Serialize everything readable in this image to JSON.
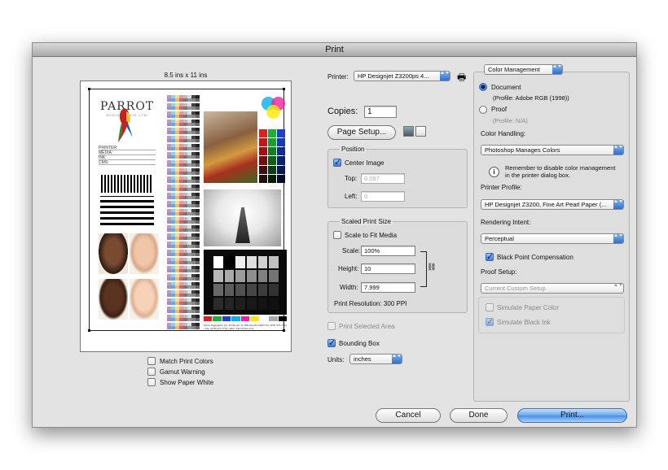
{
  "window": {
    "title": "Print"
  },
  "preview": {
    "paper_size": "8.5 ins x 11 ins",
    "page": {
      "logo_text": "PARROT",
      "logo_sub": "DIGIGRAPHIC LTD",
      "info_lines": [
        "PRINTER:",
        "MEDIA:",
        "INK:",
        "CMS:"
      ],
      "footer": "Parrot Digigraphic Ltd. 4i3 Boston St. Billerica MA 01821 Tel: (978) 670-7744 • Fax: (978) 670-7744 • Web: ParrotColor.com"
    },
    "checkboxes": [
      {
        "label": "Match Print Colors",
        "checked": false
      },
      {
        "label": "Gamut Warning",
        "checked": false
      },
      {
        "label": "Show Paper White",
        "checked": false
      }
    ]
  },
  "middle": {
    "printer_label": "Printer:",
    "printer_value": "HP Designjet Z3200ps 4...",
    "copies_label": "Copies:",
    "copies_value": "1",
    "page_setup_label": "Page Setup...",
    "position": {
      "title": "Position",
      "center_image_label": "Center Image",
      "center_image_checked": true,
      "top_label": "Top:",
      "top_value": "0.097",
      "left_label": "Left:",
      "left_value": "0"
    },
    "scaled": {
      "title": "Scaled Print Size",
      "scale_to_fit_label": "Scale to Fit Media",
      "scale_to_fit_checked": false,
      "scale_label": "Scale:",
      "scale_value": "100%",
      "height_label": "Height:",
      "height_value": "10",
      "width_label": "Width:",
      "width_value": "7.999",
      "resolution_label": "Print Resolution: 300 PPI"
    },
    "print_selected_area_label": "Print Selected Area",
    "bounding_box_label": "Bounding Box",
    "bounding_box_checked": true,
    "units_label": "Units:",
    "units_value": "inches"
  },
  "right": {
    "mode_value": "Color Management",
    "document_label": "Document",
    "document_profile": "(Profile: Adobe RGB (1998))",
    "proof_label": "Proof",
    "proof_profile": "(Profile: N/A)",
    "color_handling_label": "Color Handling:",
    "color_handling_value": "Photoshop Manages Colors",
    "reminder_text_1": "Remember to disable color management",
    "reminder_text_2": "in the printer dialog box.",
    "printer_profile_label": "Printer Profile:",
    "printer_profile_value": "HP Designjet Z3200, Fine Art Pearl Paper (...",
    "rendering_intent_label": "Rendering Intent:",
    "rendering_intent_value": "Perceptual",
    "bpc_label": "Black Point Compensation",
    "bpc_checked": true,
    "proof_setup_label": "Proof Setup:",
    "proof_setup_value": "Current Custom Setup",
    "simulate_paper_label": "Simulate Paper Color",
    "simulate_black_label": "Simulate Black Ink"
  },
  "buttons": {
    "cancel": "Cancel",
    "done": "Done",
    "print": "Print..."
  },
  "icons": {
    "info": "i",
    "chain": "⛓",
    "popup_arrows": "▲▼",
    "printer": "🖶"
  }
}
